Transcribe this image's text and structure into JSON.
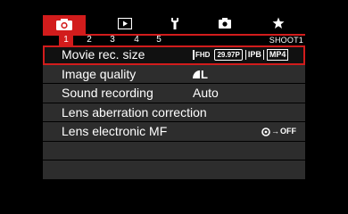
{
  "tabs": [
    {
      "name": "camera-icon"
    },
    {
      "name": "playback-icon"
    },
    {
      "name": "wrench-icon"
    },
    {
      "name": "custom-functions-icon"
    },
    {
      "name": "star-icon"
    }
  ],
  "pages": [
    "1",
    "2",
    "3",
    "4",
    "5"
  ],
  "active_page": "1",
  "shoot_label": "SHOOT1",
  "menu": {
    "items": [
      {
        "label": "Movie rec. size",
        "value": null
      },
      {
        "label": "Image quality",
        "value": "L"
      },
      {
        "label": "Sound recording",
        "value": "Auto"
      },
      {
        "label": "Lens aberration correction",
        "value": ""
      },
      {
        "label": "Lens electronic MF",
        "value": "OFF"
      },
      {
        "label": "",
        "value": ""
      },
      {
        "label": "",
        "value": ""
      }
    ],
    "movie_size_badges": {
      "resolution": "FHD",
      "frame_rate": "29.97P",
      "compression": "IPB",
      "format": "MP4"
    }
  },
  "colors": {
    "accent": "#d21c1c",
    "row_bg": "#2d2d2d",
    "background": "#000000",
    "text": "#ffffff"
  }
}
